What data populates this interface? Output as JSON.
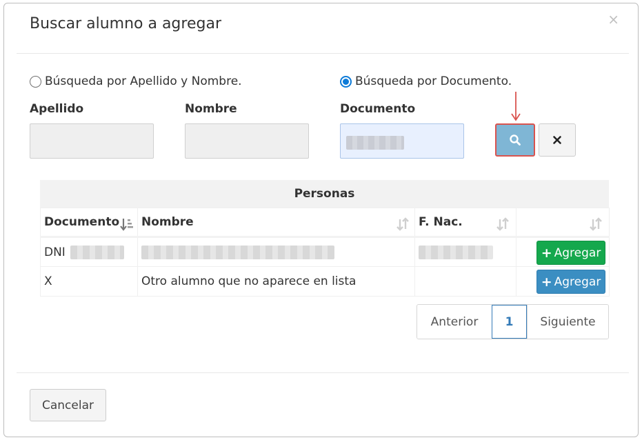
{
  "modal": {
    "title": "Buscar alumno a agregar",
    "close_symbol": "×"
  },
  "search_modes": [
    {
      "label": "Búsqueda por Apellido y Nombre.",
      "checked": false
    },
    {
      "label": "Búsqueda por Documento.",
      "checked": true
    }
  ],
  "fields": {
    "apellido": {
      "label": "Apellido",
      "value": ""
    },
    "nombre": {
      "label": "Nombre",
      "value": ""
    },
    "documento": {
      "label": "Documento",
      "value": ""
    }
  },
  "buttons": {
    "search_icon": "search-icon",
    "clear_icon": "close-icon"
  },
  "table": {
    "caption": "Personas",
    "columns": [
      "Documento",
      "Nombre",
      "F. Nac.",
      ""
    ],
    "rows": [
      {
        "documento": "DNI",
        "nombre": "",
        "fnac": "",
        "action": "Agregar"
      },
      {
        "documento": "X",
        "nombre": "Otro alumno que no aparece en lista",
        "fnac": "",
        "action": "Agregar"
      }
    ]
  },
  "pagination": {
    "prev": "Anterior",
    "current": "1",
    "next": "Siguiente"
  },
  "footer": {
    "cancel": "Cancelar"
  },
  "colors": {
    "accent": "#337ab7",
    "success": "#15a84d",
    "info": "#3b8ec2",
    "highlight_border": "#d9534f"
  }
}
